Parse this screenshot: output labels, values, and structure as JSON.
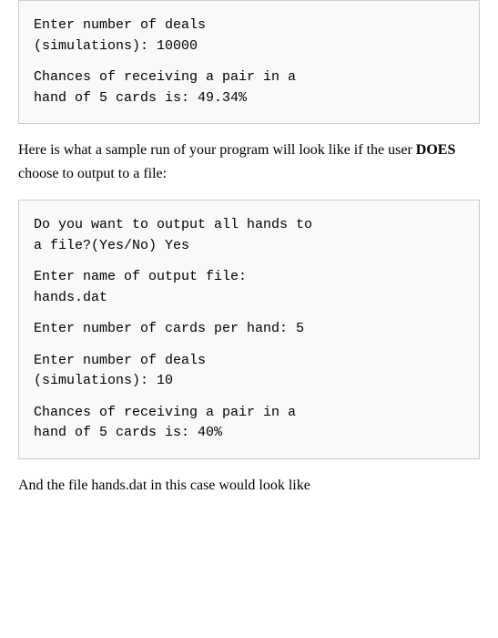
{
  "top_code_block": {
    "line1": "Enter number of deals",
    "line2": "(simulations): 10000",
    "line3": "",
    "line4": "Chances of receiving a pair in a",
    "line5": "hand of 5 cards is: 49.34%"
  },
  "prose_middle": {
    "text_before_bold": "Here is what a sample run of your program will look like if the user ",
    "bold_text": "DOES",
    "text_after_bold": " choose to output to a file:"
  },
  "second_code_block": {
    "para1_line1": "Do you want to output all hands to",
    "para1_line2": "a file?(Yes/No) Yes",
    "para2_line1": "Enter name of output file:",
    "para2_line2": "hands.dat",
    "para3_line1": "Enter number of cards per hand: 5",
    "para4_line1": "Enter number of deals",
    "para4_line2": "(simulations): 10",
    "para5_line1": "Chances of receiving a pair in a",
    "para5_line2": "hand of 5 cards is: 40%"
  },
  "bottom_prose": {
    "text": "And the file hands.dat in this case would look like"
  }
}
